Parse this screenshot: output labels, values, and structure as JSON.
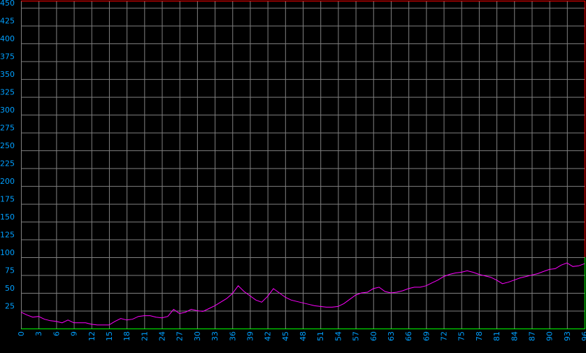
{
  "colors": {
    "background": "#000000",
    "grid": "#808080",
    "top_axis": "#ff0000",
    "right_axis_top": "#ff0000",
    "right_axis_bottom": "#00ff00",
    "bottom_axis": "#00ff00",
    "line": "#ff00ff",
    "tick_labels": "#00a0ff"
  },
  "chart_data": {
    "type": "line",
    "title": "",
    "xlabel": "",
    "ylabel": "",
    "grid": true,
    "xlim": [
      0,
      96
    ],
    "ylim": [
      0,
      460
    ],
    "x_ticks": [
      0,
      3,
      6,
      9,
      12,
      15,
      18,
      21,
      24,
      27,
      30,
      33,
      36,
      39,
      42,
      45,
      48,
      51,
      54,
      57,
      60,
      63,
      66,
      69,
      72,
      75,
      78,
      81,
      84,
      87,
      90,
      93,
      96
    ],
    "x_tick_labels": [
      "0",
      "3",
      "6",
      "9",
      "12",
      "15",
      "18",
      "21",
      "24",
      "27",
      "30",
      "33",
      "36",
      "39",
      "42",
      "45",
      "48",
      "51",
      "54",
      "57",
      "60",
      "63",
      "66",
      "69",
      "72",
      "75",
      "78",
      "81",
      "84",
      "87",
      "90",
      "93",
      "96"
    ],
    "y_ticks": [
      25,
      50,
      75,
      100,
      125,
      150,
      175,
      200,
      225,
      250,
      275,
      300,
      325,
      350,
      375,
      400,
      425,
      450
    ],
    "y_tick_labels": [
      "25",
      "50",
      "75",
      "100",
      "125",
      "150",
      "175",
      "200",
      "225",
      "250",
      "275",
      "300",
      "325",
      "350",
      "375",
      "400",
      "425",
      "450"
    ],
    "series": [
      {
        "x": [
          0,
          1,
          2,
          3,
          4,
          5,
          6,
          7,
          8,
          9,
          10,
          11,
          12,
          13,
          14,
          15,
          16,
          17,
          18,
          19,
          20,
          21,
          22,
          23,
          24,
          25,
          26,
          27,
          28,
          29,
          30,
          31,
          32,
          33,
          34,
          35,
          36,
          37,
          38,
          39,
          40,
          41,
          42,
          43,
          44,
          45,
          46,
          47,
          48,
          49,
          50,
          51,
          52,
          53,
          54,
          55,
          56,
          57,
          58,
          59,
          60,
          61,
          62,
          63,
          64,
          65,
          66,
          67,
          68,
          69,
          70,
          71,
          72,
          73,
          74,
          75,
          76,
          77,
          78,
          79,
          80,
          81,
          82,
          83,
          84,
          85,
          86,
          87,
          88,
          89,
          90,
          91,
          92,
          93,
          94,
          95,
          96
        ],
        "y": [
          23,
          19,
          16,
          17,
          13,
          11,
          10,
          8,
          12,
          8,
          8,
          8,
          6,
          5,
          5,
          5,
          10,
          14,
          12,
          13,
          17,
          18,
          18,
          16,
          15,
          17,
          27,
          21,
          23,
          27,
          25,
          24,
          28,
          32,
          37,
          42,
          49,
          60,
          52,
          46,
          40,
          37,
          45,
          56,
          50,
          44,
          40,
          38,
          36,
          34,
          32,
          31,
          30,
          30,
          31,
          35,
          41,
          47,
          50,
          51,
          56,
          58,
          52,
          50,
          51,
          53,
          56,
          58,
          58,
          60,
          64,
          68,
          73,
          76,
          78,
          79,
          81,
          79,
          76,
          74,
          72,
          68,
          63,
          65,
          68,
          71,
          73,
          75,
          77,
          80,
          83,
          84,
          89,
          92,
          87,
          88,
          91
        ]
      }
    ]
  }
}
